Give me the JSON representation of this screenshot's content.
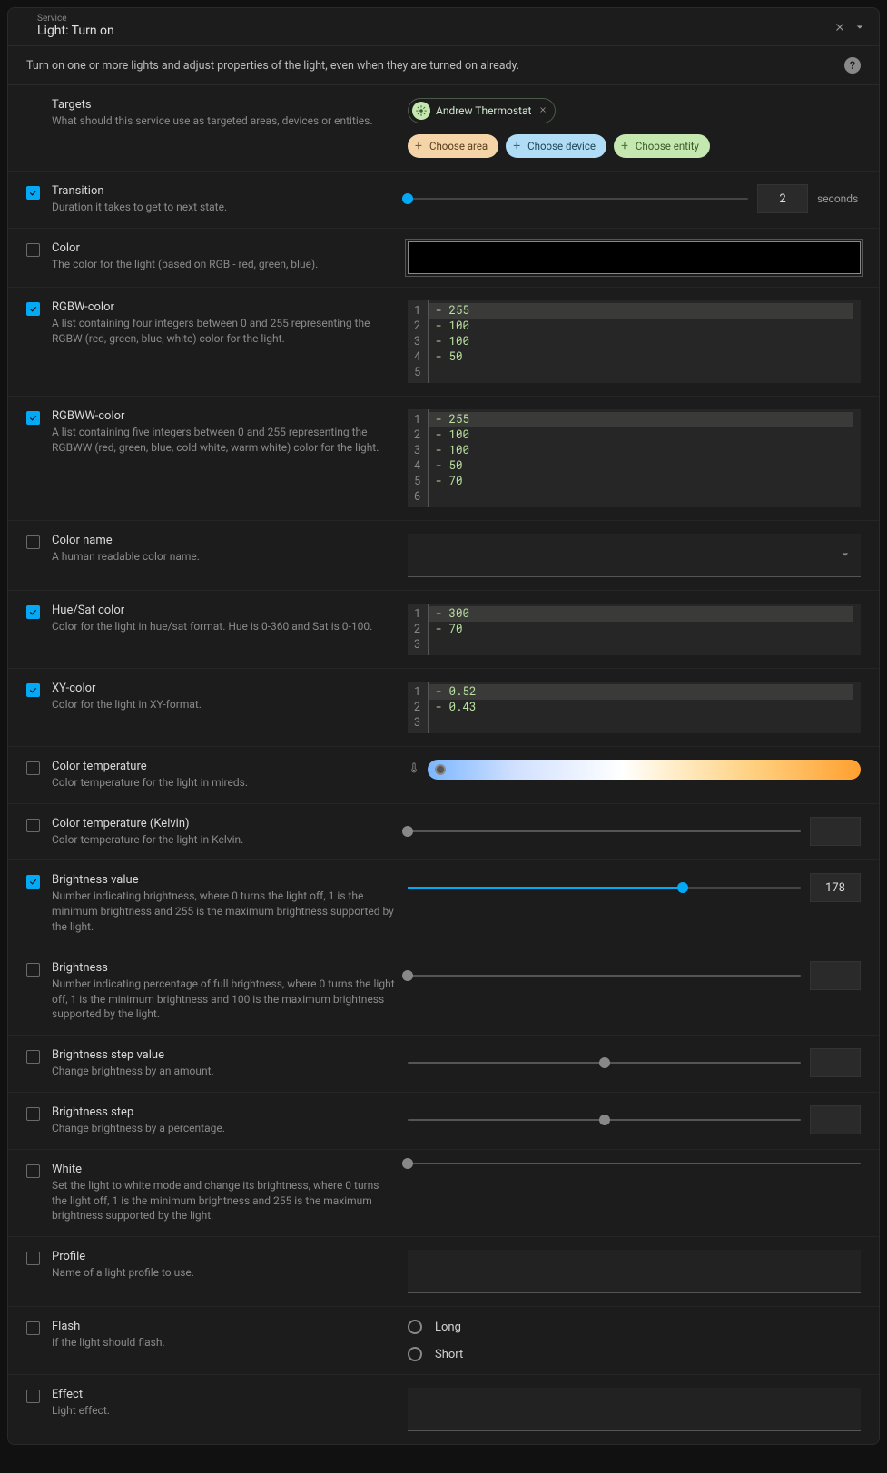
{
  "service": {
    "label": "Service",
    "value": "Light: Turn on",
    "description": "Turn on one or more lights and adjust properties of the light, even when they are turned on already.",
    "help_glyph": "?"
  },
  "targets": {
    "title": "Targets",
    "desc": "What should this service use as targeted areas, devices or entities.",
    "entity_chip": "Andrew Thermostat",
    "choose_area": "Choose area",
    "choose_device": "Choose device",
    "choose_entity": "Choose entity"
  },
  "fields": {
    "transition": {
      "title": "Transition",
      "desc": "Duration it takes to get to next state.",
      "checked": true,
      "value": "2",
      "unit": "seconds",
      "slider_percent": 0
    },
    "color": {
      "title": "Color",
      "desc": "The color for the light (based on RGB - red, green, blue).",
      "checked": false,
      "hex": "#000000"
    },
    "rgbw": {
      "title": "RGBW-color",
      "desc": "A list containing four integers between 0 and 255 representing the RGBW (red, green, blue, white) color for the light.",
      "checked": true,
      "lines": [
        "- 255",
        "- 100",
        "- 100",
        "- 50",
        ""
      ]
    },
    "rgbww": {
      "title": "RGBWW-color",
      "desc": "A list containing five integers between 0 and 255 representing the RGBWW (red, green, blue, cold white, warm white) color for the light.",
      "checked": true,
      "lines": [
        "- 255",
        "- 100",
        "- 100",
        "- 50",
        "- 70",
        ""
      ]
    },
    "color_name": {
      "title": "Color name",
      "desc": "A human readable color name.",
      "checked": false
    },
    "hs": {
      "title": "Hue/Sat color",
      "desc": "Color for the light in hue/sat format. Hue is 0-360 and Sat is 0-100.",
      "checked": true,
      "lines": [
        "- 300",
        "- 70",
        ""
      ]
    },
    "xy": {
      "title": "XY-color",
      "desc": "Color for the light in XY-format.",
      "checked": true,
      "lines": [
        "- 0.52",
        "- 0.43",
        ""
      ]
    },
    "color_temp": {
      "title": "Color temperature",
      "desc": "Color temperature for the light in mireds.",
      "checked": false
    },
    "color_temp_k": {
      "title": "Color temperature (Kelvin)",
      "desc": "Color temperature for the light in Kelvin.",
      "checked": false
    },
    "brightness_value": {
      "title": "Brightness value",
      "desc": "Number indicating brightness, where 0 turns the light off, 1 is the minimum brightness and 255 is the maximum brightness supported by the light.",
      "checked": true,
      "value": "178",
      "slider_percent": 70
    },
    "brightness_pct": {
      "title": "Brightness",
      "desc": "Number indicating percentage of full brightness, where 0 turns the light off, 1 is the minimum brightness and 100 is the maximum brightness supported by the light.",
      "checked": false
    },
    "brightness_step": {
      "title": "Brightness step value",
      "desc": "Change brightness by an amount.",
      "checked": false
    },
    "brightness_step_pct": {
      "title": "Brightness step",
      "desc": "Change brightness by a percentage.",
      "checked": false
    },
    "white": {
      "title": "White",
      "desc": "Set the light to white mode and change its brightness, where 0 turns the light off, 1 is the minimum brightness and 255 is the maximum brightness supported by the light.",
      "checked": false
    },
    "profile": {
      "title": "Profile",
      "desc": "Name of a light profile to use.",
      "checked": false
    },
    "flash": {
      "title": "Flash",
      "desc": "If the light should flash.",
      "checked": false,
      "options": [
        "Long",
        "Short"
      ]
    },
    "effect": {
      "title": "Effect",
      "desc": "Light effect.",
      "checked": false
    }
  }
}
